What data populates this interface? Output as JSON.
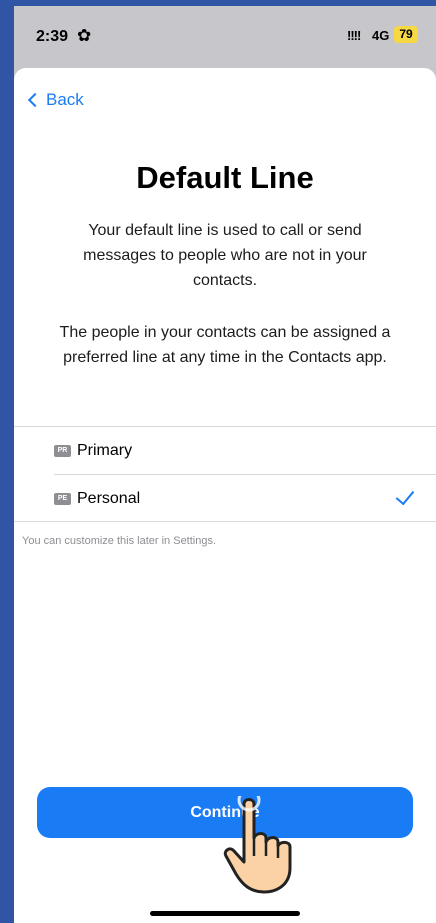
{
  "status_bar": {
    "time": "2:39",
    "signal": "!!!!",
    "network": "4G",
    "battery": "79"
  },
  "nav": {
    "back_label": "Back"
  },
  "main": {
    "title": "Default Line",
    "description_1": "Your default line is used to call or send messages to people who are not in your contacts.",
    "description_2": "The people in your contacts can be assigned a preferred line at any time in the Contacts app."
  },
  "options": [
    {
      "badge": "PR",
      "label": "Primary",
      "selected": false
    },
    {
      "badge": "PE",
      "label": "Personal",
      "selected": true
    }
  ],
  "hint": "You can customize this later in Settings.",
  "continue_label": "Continue",
  "colors": {
    "accent": "#1a7cf5",
    "frame": "#2f55a4",
    "battery": "#f5d842"
  }
}
